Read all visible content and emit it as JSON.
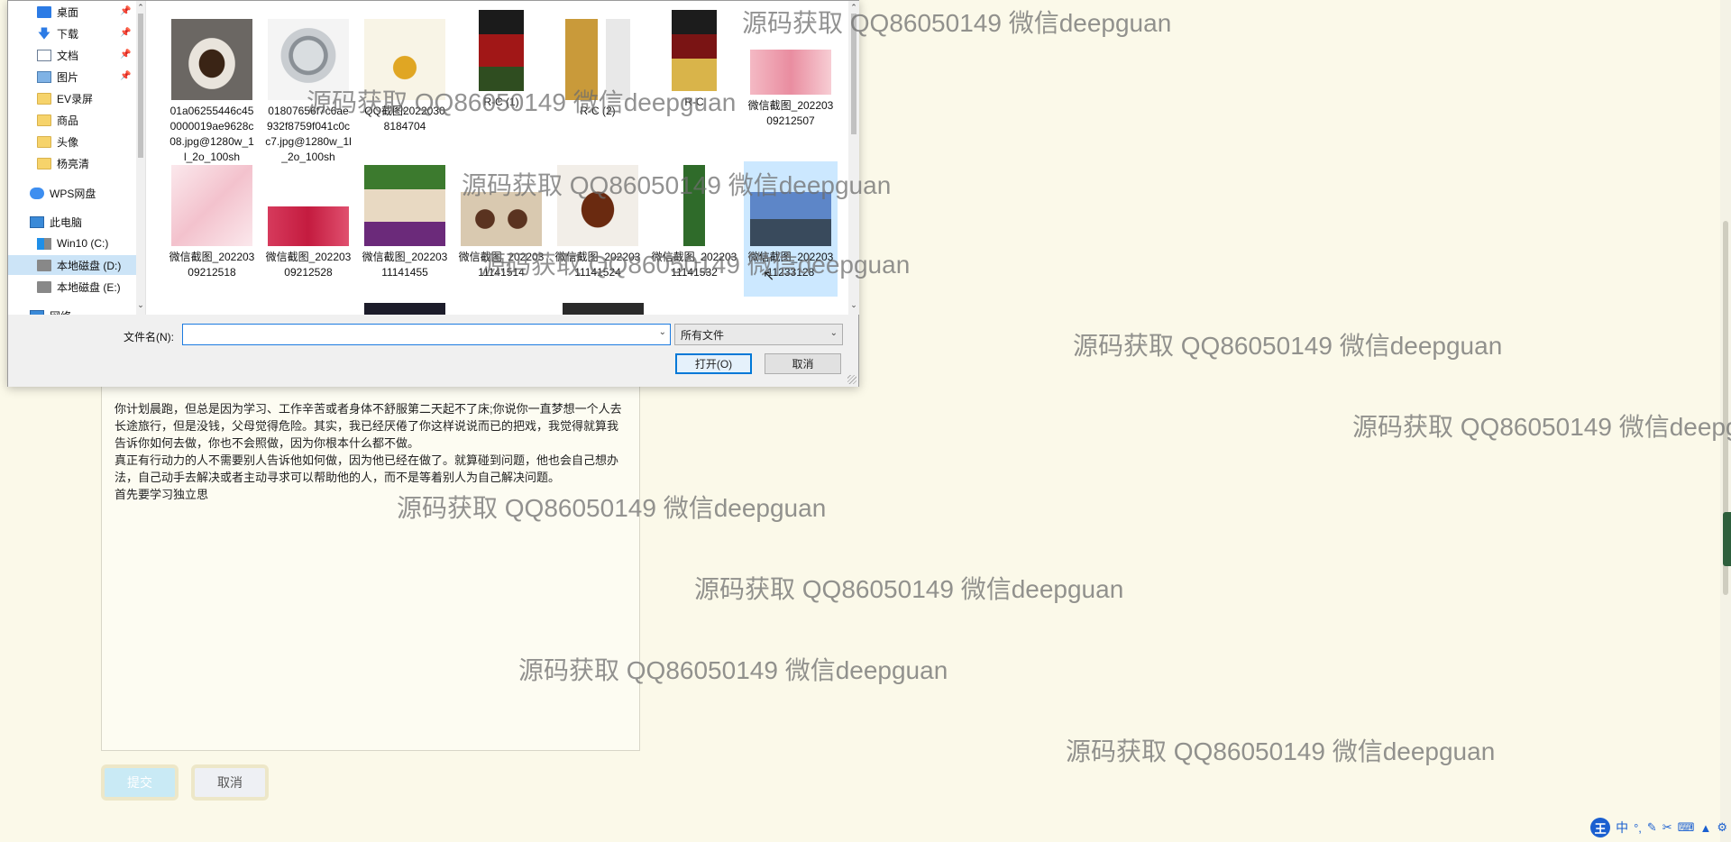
{
  "dialog": {
    "nav": [
      {
        "label": "桌面",
        "icon": "desktop-icon",
        "pinned": true
      },
      {
        "label": "下载",
        "icon": "download-icon",
        "pinned": true
      },
      {
        "label": "文档",
        "icon": "document-icon",
        "pinned": true
      },
      {
        "label": "图片",
        "icon": "picture-icon",
        "pinned": true
      },
      {
        "label": "EV录屏",
        "icon": "folder-icon"
      },
      {
        "label": "商品",
        "icon": "folder-icon"
      },
      {
        "label": "头像",
        "icon": "folder-icon"
      },
      {
        "label": "杨亮清",
        "icon": "folder-icon"
      },
      {
        "label": "WPS网盘",
        "icon": "cloud-icon"
      },
      {
        "label": "此电脑",
        "icon": "computer-icon"
      },
      {
        "label": "Win10 (C:)",
        "icon": "windows-drive-icon"
      },
      {
        "label": "本地磁盘 (D:)",
        "icon": "drive-icon",
        "selected": true
      },
      {
        "label": "本地磁盘 (E:)",
        "icon": "drive-icon"
      },
      {
        "label": "网络",
        "icon": "network-icon"
      }
    ],
    "files": [
      {
        "name": "01a06255446c450000019ae9628c08.jpg@1280w_1l_2o_100sh"
      },
      {
        "name": "01807656f7c6ae932f8759f041c0cc7.jpg@1280w_1l_2o_100sh"
      },
      {
        "name": "QQ截图20220308184704"
      },
      {
        "name": "R-C (1)"
      },
      {
        "name": "R-C (2)"
      },
      {
        "name": "R-C"
      },
      {
        "name": "微信截图_20220309212507"
      },
      {
        "name": "微信截图_20220309212518"
      },
      {
        "name": "微信截图_20220309212528"
      },
      {
        "name": "微信截图_20220311141455"
      },
      {
        "name": "微信截图_20220311141514"
      },
      {
        "name": "微信截图_20220311141524"
      },
      {
        "name": "微信截图_20220311141532"
      },
      {
        "name": "微信截图_20220311233128",
        "selected": true
      }
    ],
    "filename_label": "文件名(N):",
    "filename_value": "",
    "filter_label": "所有文件",
    "open_label": "打开(O)",
    "cancel_label": "取消"
  },
  "page": {
    "text_lines": [
      "你计划晨跑，但总是因为学习、工作辛苦或者身体不舒服第二天起不了床;你说你一直梦想一个人去长途旅行，但是没钱，父母觉得危险。其实，我已经厌倦了你这样说说而已的把戏，我觉得就算我告诉你如何去做，你也不会照做，因为你根本什么都不做。",
      "真正有行动力的人不需要别人告诉他如何做，因为他已经在做了。就算碰到问题，他也会自己想办法，自己动手去解决或者主动寻求可以帮助他的人，而不是等着别人为自己解决问题。",
      "首先要学习独立思"
    ],
    "submit_label": "提交",
    "cancel_label": "取消"
  },
  "watermark_text": "源码获取 QQ86050149 微信deepguan",
  "ime": {
    "logo": "王",
    "mode": "中"
  }
}
